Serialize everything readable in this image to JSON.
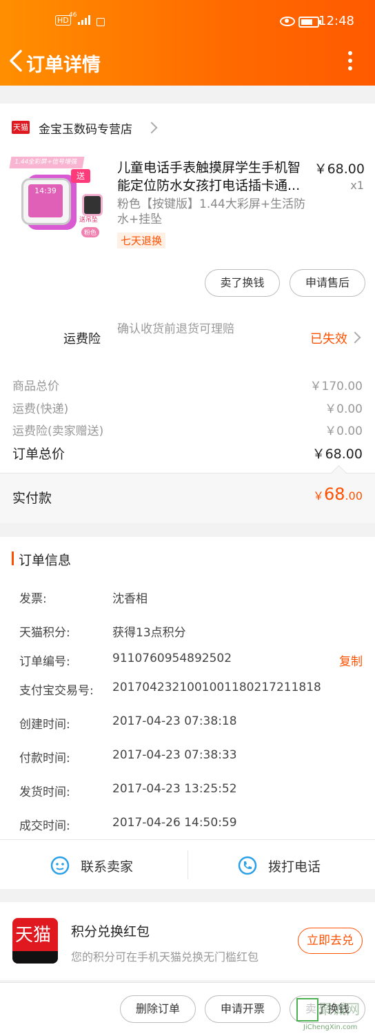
{
  "status_bar": {
    "hd": "HD",
    "signal": "46",
    "time": "12:48"
  },
  "header": {
    "title": "订单详情"
  },
  "store": {
    "badge": "天猫",
    "name": "金宝玉数码专营店"
  },
  "product": {
    "thumb_banner": "1.44全彩屏+信号增强",
    "thumb_gift": "送",
    "thumb_gift_label": "送吊坠",
    "thumb_color": "粉色",
    "thumb_time": "14:39",
    "title": "儿童电话手表触摸屏学生手机智能定位防水女孩打电话插卡通...",
    "price": "￥68.00",
    "qty": "x1",
    "spec": "粉色【按键版】1.44大彩屏+生活防水+挂坠",
    "tag": "七天退换"
  },
  "actions": {
    "sell": "卖了换钱",
    "after_sale": "申请售后"
  },
  "insurance": {
    "label": "运费险",
    "desc": "确认收货前退货可理赔",
    "status": "已失效"
  },
  "summary": {
    "rows": [
      {
        "label": "商品总价",
        "value": "￥170.00"
      },
      {
        "label": "运费(快递)",
        "value": "￥0.00"
      },
      {
        "label": "运费险(卖家赠送)",
        "value": "￥0.00"
      }
    ],
    "total_label": "订单总价",
    "total_value": "￥68.00",
    "paid_label": "实付款",
    "paid_symbol": "￥",
    "paid_int": "68",
    "paid_dec": ".00"
  },
  "order_info": {
    "heading": "订单信息",
    "copy": "复制",
    "rows": [
      {
        "label": "发票:",
        "value": "沈香相"
      },
      {
        "label": "天猫积分:",
        "value": "获得13点积分"
      },
      {
        "label": "订单编号:",
        "value": "9110760954892502"
      },
      {
        "label": "支付宝交易号:",
        "value": "2017042321001001180217211818"
      },
      {
        "label": "创建时间:",
        "value": "2017-04-23 07:38:18"
      },
      {
        "label": "付款时间:",
        "value": "2017-04-23 07:38:33"
      },
      {
        "label": "发货时间:",
        "value": "2017-04-23 13:25:52"
      },
      {
        "label": "成交时间:",
        "value": "2017-04-26 14:50:59"
      }
    ]
  },
  "contact": {
    "seller": "联系卖家",
    "phone": "拨打电话"
  },
  "promo": {
    "logo": "天猫",
    "title": "积分兑换红包",
    "desc": "您的积分可在手机天猫兑换无门槛红包",
    "button": "立即去兑"
  },
  "bottom": {
    "delete": "删除订单",
    "invoice": "申请开票",
    "sell": "卖了换钱"
  },
  "watermark": {
    "main": "聚诚网",
    "sub": "JiChengXin.com"
  },
  "colors": {
    "accent": "#ff5000",
    "header": "#ff7a00",
    "tmall": "#e0181f"
  }
}
